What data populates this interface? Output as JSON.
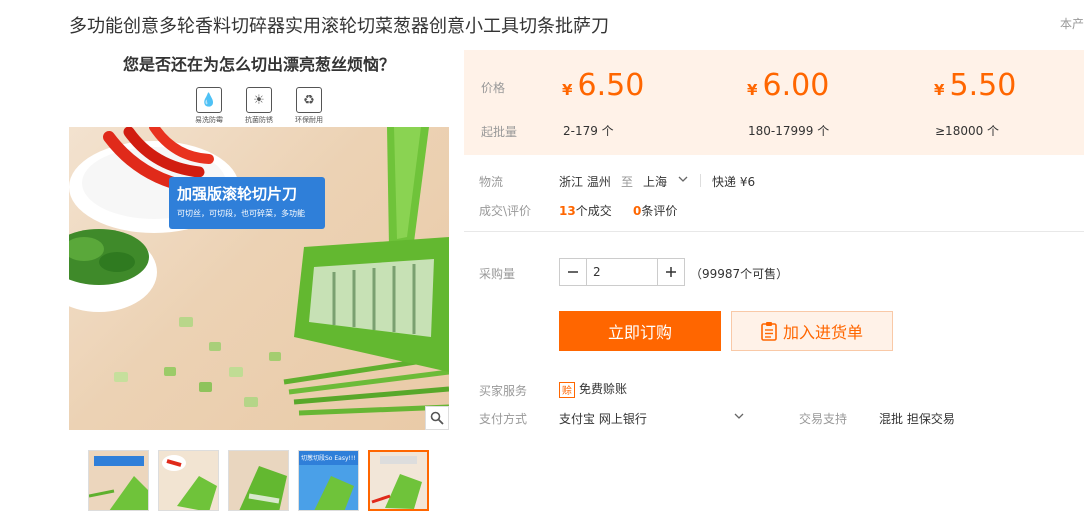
{
  "product": {
    "title": "多功能创意多轮香料切碎器实用滚轮切菜葱器创意小工具切条批萨刀",
    "corner_text": "本产"
  },
  "image": {
    "headline": "您是否还在为怎么切出漂亮葱丝烦恼？",
    "features": [
      "易洗防霉",
      "抗菌防锈",
      "环保耐用"
    ],
    "tag_title": "加强版滚轮切片刀",
    "tag_sub": "可切丝，可切段，也可碎菜，多功能",
    "zoom_icon": "search-icon"
  },
  "thumbnails": [
    {
      "caption": ""
    },
    {
      "caption": ""
    },
    {
      "caption": ""
    },
    {
      "caption": "切葱切段So Easy!!!"
    },
    {
      "caption": ""
    }
  ],
  "pricing": {
    "price_label": "价格",
    "batch_label": "起批量",
    "currency": "¥",
    "tiers": [
      {
        "price": "6.50",
        "range": "2-179 个"
      },
      {
        "price": "6.00",
        "range": "180-17999 个"
      },
      {
        "price": "5.50",
        "range": "≥18000 个"
      }
    ]
  },
  "logistics": {
    "label": "物流",
    "origin": "浙江 温州",
    "to": "至",
    "destination": "上海",
    "shipping": "快递 ¥6"
  },
  "reviews": {
    "label": "成交\\评价",
    "deals_count": "13",
    "deals_text": "个成交",
    "review_count": "0",
    "review_text": "条评价"
  },
  "purchase": {
    "label": "采购量",
    "quantity": "2",
    "available": "（99987个可售）",
    "buy_label": "立即订购",
    "cart_label": "加入进货单"
  },
  "services": {
    "label": "买家服务",
    "badge": "赊",
    "item": "免费赊账"
  },
  "payment": {
    "label": "支付方式",
    "methods": "支付宝  网上银行",
    "support_label": "交易支持",
    "support_items": "混批  担保交易"
  },
  "colors": {
    "accent": "#ff6600",
    "price_bg": "#fff2e8",
    "tag_blue": "#2f7fd9",
    "slicer_green": "#6fc33a"
  }
}
